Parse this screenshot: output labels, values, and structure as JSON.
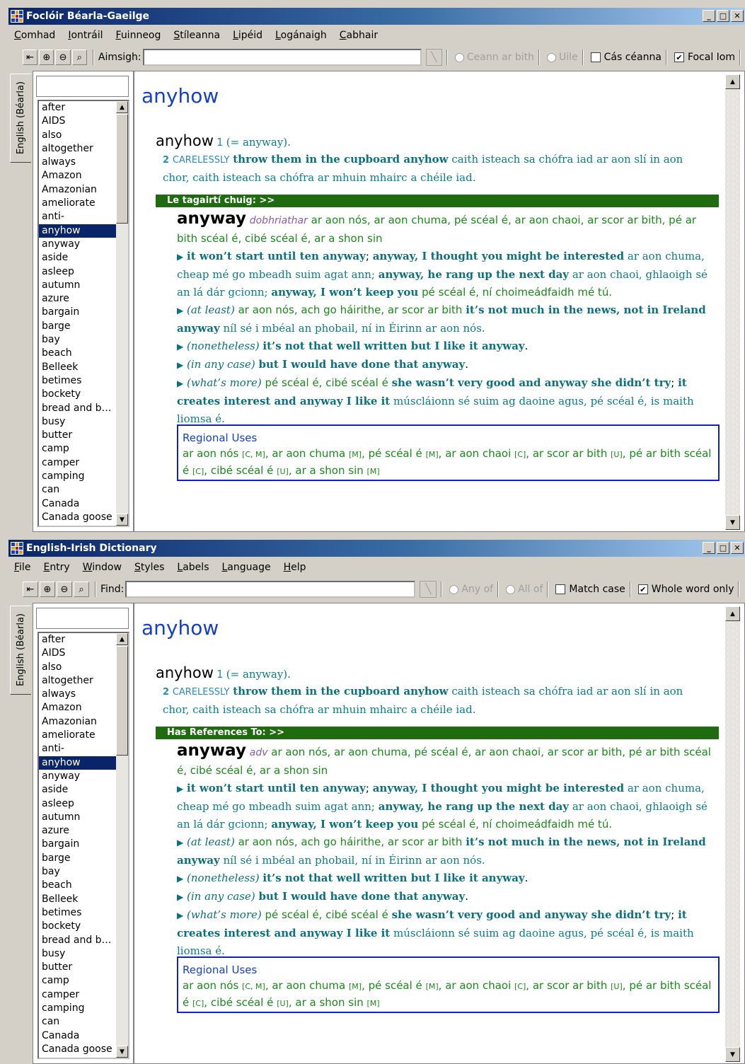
{
  "windows": [
    {
      "title": "Foclóir Béarla-Gaeilge",
      "menu": [
        "Comhad",
        "Iontráil",
        "Fuinneog",
        "Stíleanna",
        "Lipéid",
        "Logánaigh",
        "Cabhair"
      ],
      "find_label": "Aimsigh:",
      "find_value": "",
      "opt_any": "Ceann ar bith",
      "opt_all": "Uile",
      "opt_case": "Cás céanna",
      "opt_whole": "Focal Iom",
      "side_tab": "English (Béarla)",
      "refbar": "Le tagairtí chuig: >>",
      "pos": "dobhriathar"
    },
    {
      "title": "English-Irish Dictionary",
      "menu": [
        "File",
        "Entry",
        "Window",
        "Styles",
        "Labels",
        "Language",
        "Help"
      ],
      "find_label": "Find:",
      "find_value": "",
      "opt_any": "Any of",
      "opt_all": "All of",
      "opt_case": "Match case",
      "opt_whole": "Whole word only",
      "side_tab": "English (Béarla)",
      "refbar": "Has References To: >>",
      "pos": "adv"
    }
  ],
  "words": [
    "after",
    "AIDS",
    "also",
    "altogether",
    "always",
    "Amazon",
    "Amazonian",
    "ameliorate",
    "anti-",
    "anyhow",
    "anyway",
    "aside",
    "asleep",
    "autumn",
    "azure",
    "bargain",
    "barge",
    "bay",
    "beach",
    "Belleek",
    "betimes",
    "bockety",
    "bread and b…",
    "busy",
    "butter",
    "camp",
    "camper",
    "camping",
    "can",
    "Canada",
    "Canada goose"
  ],
  "selected_word": "anyhow",
  "entry": {
    "headword": "anyhow",
    "hw2": "anyhow",
    "sense1_num": "1",
    "sense1_ref": "(= anyway).",
    "sense2_num": "2",
    "sense2_label": "CARELESSLY",
    "sense2_ex": "throw them in the cupboard anyhow",
    "sense2_tr": "caith isteach sa chófra iad ar aon slí in aon chor, caith isteach sa chófra ar mhuin mhairc a chéile iad.",
    "ref_head": "anyway",
    "ref_tr": "ar aon nós, ar aon chuma, pé scéal é, ar aon chaoi, ar scor ar bith, pé ar bith scéal é, cibé scéal é, ar a shon sin",
    "ex1": "it won’t start until ten anyway",
    "ex1b": "anyway, I thought you might be interested",
    "ex1b_tr": "ar aon chuma, cheap mé go mbeadh suim agat ann;",
    "ex1c": "anyway, he rang up the next day",
    "ex1c_tr": "ar aon chaoi, ghlaoigh sé an lá dár gcionn;",
    "ex1d": "anyway, I won’t keep you",
    "ex1d_tr": "pé scéal é, ní choimeádfaidh mé tú.",
    "s2_label": "(at least)",
    "s2_tr": "ar aon nós, ach go háirithe, ar scor ar bith",
    "s2_ex": "it’s not much in the news, not in Ireland anyway",
    "s2_ex_tr": "níl sé i mbéal an phobail, ní in Éirinn ar aon nós.",
    "s3_label": "(nonetheless)",
    "s3_ex": "it’s not that well written but I like it anyway",
    "s4_label": "(in any case)",
    "s4_ex": "but I would have done that anyway",
    "s5_label": "(what’s more)",
    "s5_tr": "pé scéal é, cibé scéal é",
    "s5_ex": "she wasn’t very good and anyway she didn’t try",
    "s5_ex2": "it creates interest and anyway I like it",
    "s5_ex2_tr": "múscláionn sé suim ag daoine agus, pé scéal é, is maith liomsa é.",
    "regional_title": "Regional Uses",
    "regional": [
      {
        "text": "ar aon nós",
        "tag": "[C, M]"
      },
      {
        "text": "ar aon chuma",
        "tag": "[M]"
      },
      {
        "text": "pé scéal é",
        "tag": "[M]"
      },
      {
        "text": "ar aon chaoi",
        "tag": "[C]"
      },
      {
        "text": "ar scor ar bith",
        "tag": "[U]"
      },
      {
        "text": "pé ar bith scéal é",
        "tag": "[C]"
      },
      {
        "text": "cibé scéal é",
        "tag": "[U]"
      },
      {
        "text": "ar a shon sin",
        "tag": "[M]"
      }
    ]
  }
}
